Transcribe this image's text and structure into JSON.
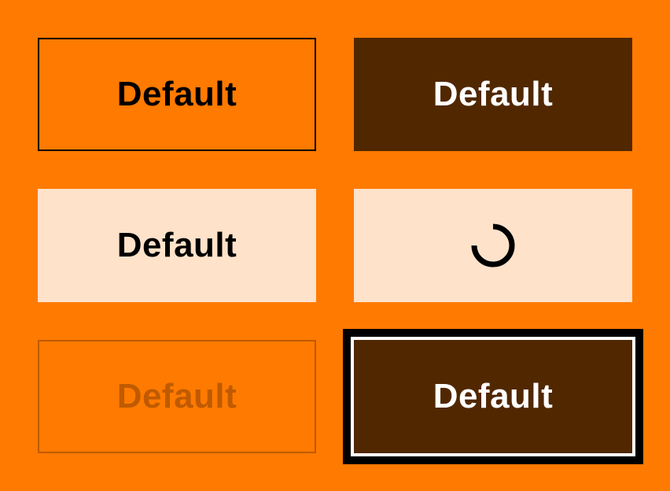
{
  "colors": {
    "page_background": "#FF7A00",
    "dark_fill": "#512700",
    "light_fill": "#FEE2CA",
    "text_dark": "#000000",
    "text_light": "#FFFFFF"
  },
  "buttons": {
    "outline": {
      "label": "Default"
    },
    "solid_dark": {
      "label": "Default"
    },
    "light": {
      "label": "Default"
    },
    "loading": {
      "icon": "loading-spinner-icon"
    },
    "disabled": {
      "label": "Default"
    },
    "focused": {
      "label": "Default"
    }
  }
}
